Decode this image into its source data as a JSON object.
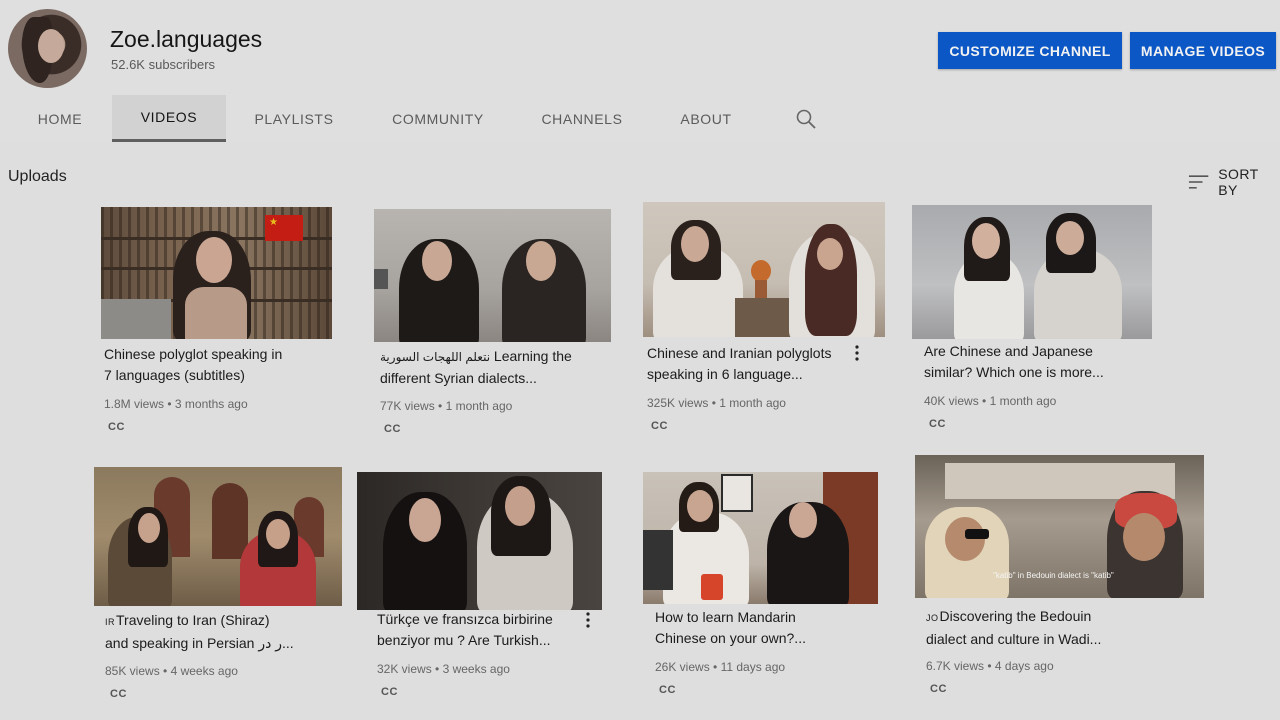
{
  "channel": {
    "name": "Zoe.languages",
    "subscribers": "52.6K subscribers"
  },
  "header_buttons": {
    "customize": "CUSTOMIZE CHANNEL",
    "manage": "MANAGE VIDEOS"
  },
  "tabs": [
    {
      "label": "HOME"
    },
    {
      "label": "VIDEOS",
      "active": true
    },
    {
      "label": "PLAYLISTS"
    },
    {
      "label": "COMMUNITY"
    },
    {
      "label": "CHANNELS"
    },
    {
      "label": "ABOUT"
    }
  ],
  "section": {
    "title": "Uploads",
    "sort_label": "SORT BY"
  },
  "videos": [
    {
      "line1": "Chinese polyglot speaking in",
      "line2": "7 languages (subtitles)",
      "views": "1.8M views",
      "age": "3 months ago",
      "cc": "CC"
    },
    {
      "line1_rtl": "نتعلم اللهجات السورية",
      "line1": " Learning the",
      "line2": "different Syrian dialects...",
      "views": "77K views",
      "age": "1 month ago",
      "cc": "CC"
    },
    {
      "line1": "Chinese and Iranian polyglots",
      "line2": "speaking in 6 language...",
      "views": "325K views",
      "age": "1 month ago",
      "cc": "CC"
    },
    {
      "line1": "Are Chinese and Japanese",
      "line2": "similar? Which one is more...",
      "views": "40K views",
      "age": "1 month ago",
      "cc": "CC"
    },
    {
      "prefix": "IR",
      "line1": "Traveling to Iran (Shiraz)",
      "line2": "and speaking in Persian ر در...",
      "views": "85K views",
      "age": "4 weeks ago",
      "cc": "CC"
    },
    {
      "line1": "Türkçe ve fransızca birbirine",
      "line2": "benziyor mu ? Are Turkish...",
      "views": "32K views",
      "age": "3 weeks ago",
      "cc": "CC"
    },
    {
      "line1": "How to learn Mandarin",
      "line2": "Chinese on your own?...",
      "views": "26K views",
      "age": "11 days ago",
      "cc": "CC"
    },
    {
      "prefix": "JO",
      "line1": "Discovering the Bedouin",
      "line2": "dialect and culture in Wadi...",
      "views": "6.7K views",
      "age": "4 days ago",
      "cc": "CC",
      "thumb_caption": "\"katib\" in Bedouin dialect is \"katib\""
    }
  ],
  "icons": {
    "search": "search-icon",
    "sort": "sort-lines-icon",
    "more": "vertical-dots-icon"
  },
  "colors": {
    "accent_button": "#0b57c5",
    "page_background": "#dedede"
  }
}
